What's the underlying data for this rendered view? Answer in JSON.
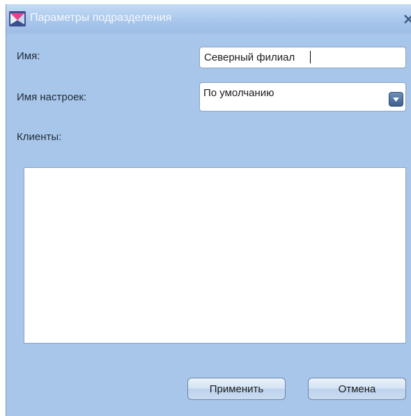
{
  "window": {
    "title": "Параметры подразделения",
    "icon": "envelope-icon",
    "close_icon": "close-icon"
  },
  "form": {
    "name_label": "Имя:",
    "name_value": "Северный филиал",
    "settings_label": "Имя настроек:",
    "settings_value": "По умолчанию",
    "clients_label": "Клиенты:",
    "clients": []
  },
  "buttons": {
    "apply": "Применить",
    "cancel": "Отмена"
  },
  "colors": {
    "background": "#a8c6e9",
    "titlebar": "#b8d2f0",
    "accent": "#3d5f8d"
  }
}
